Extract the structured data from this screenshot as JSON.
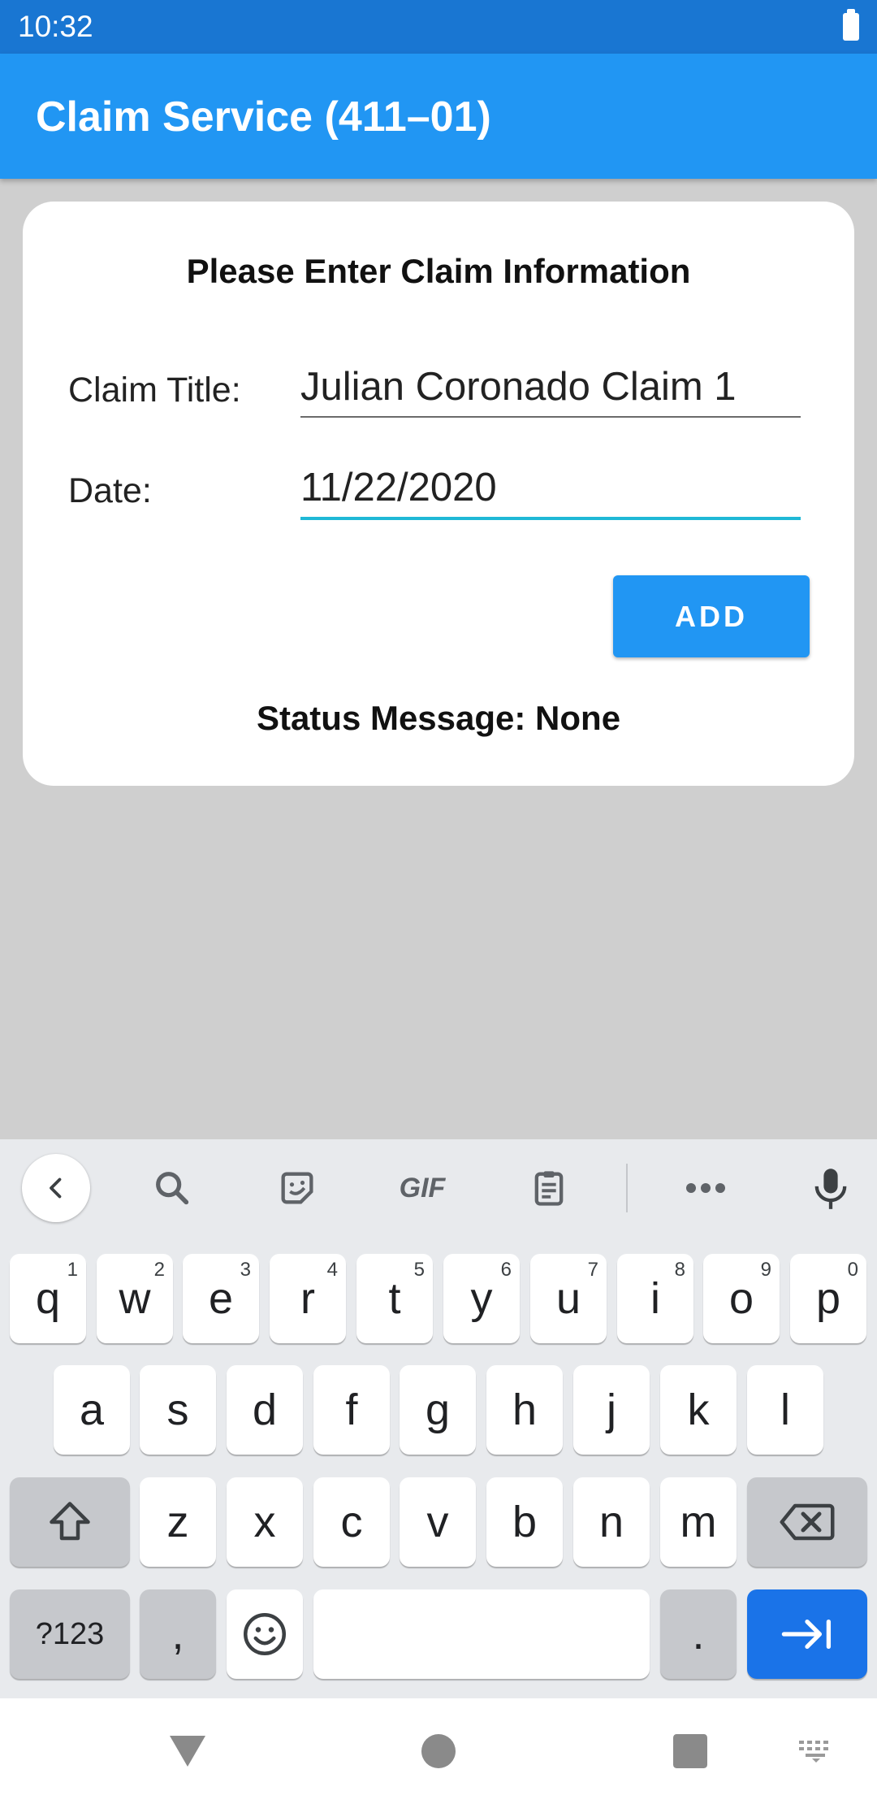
{
  "status_bar": {
    "time": "10:32",
    "battery_icon": "battery-icon"
  },
  "app_bar": {
    "title": "Claim Service (411–01)"
  },
  "form": {
    "heading": "Please Enter Claim Information",
    "claim_title_label": "Claim Title:",
    "claim_title_value": "Julian Coronado Claim 1",
    "date_label": "Date:",
    "date_value": "11/22/2020",
    "add_button_label": "ADD",
    "status_message": "Status Message: None"
  },
  "keyboard": {
    "toolbar": [
      "back-icon",
      "search-icon",
      "sticker-icon",
      "GIF",
      "clipboard-icon",
      "more-icon",
      "mic-icon"
    ],
    "gif_label": "GIF",
    "row1": [
      {
        "key": "q",
        "hint": "1"
      },
      {
        "key": "w",
        "hint": "2"
      },
      {
        "key": "e",
        "hint": "3"
      },
      {
        "key": "r",
        "hint": "4"
      },
      {
        "key": "t",
        "hint": "5"
      },
      {
        "key": "y",
        "hint": "6"
      },
      {
        "key": "u",
        "hint": "7"
      },
      {
        "key": "i",
        "hint": "8"
      },
      {
        "key": "o",
        "hint": "9"
      },
      {
        "key": "p",
        "hint": "0"
      }
    ],
    "row2": [
      "a",
      "s",
      "d",
      "f",
      "g",
      "h",
      "j",
      "k",
      "l"
    ],
    "row3": [
      "z",
      "x",
      "c",
      "v",
      "b",
      "n",
      "m"
    ],
    "symbols_label": "?123",
    "comma_label": ",",
    "period_label": ".",
    "accent_color": "#1a73e8"
  },
  "nav_bar": {
    "items": [
      "back-triangle-icon",
      "home-circle-icon",
      "recents-square-icon",
      "keyboard-switch-icon"
    ]
  },
  "colors": {
    "app_bar": "#2196f3",
    "status_bar": "#1976d2",
    "date_underline": "#1fb8d6"
  }
}
